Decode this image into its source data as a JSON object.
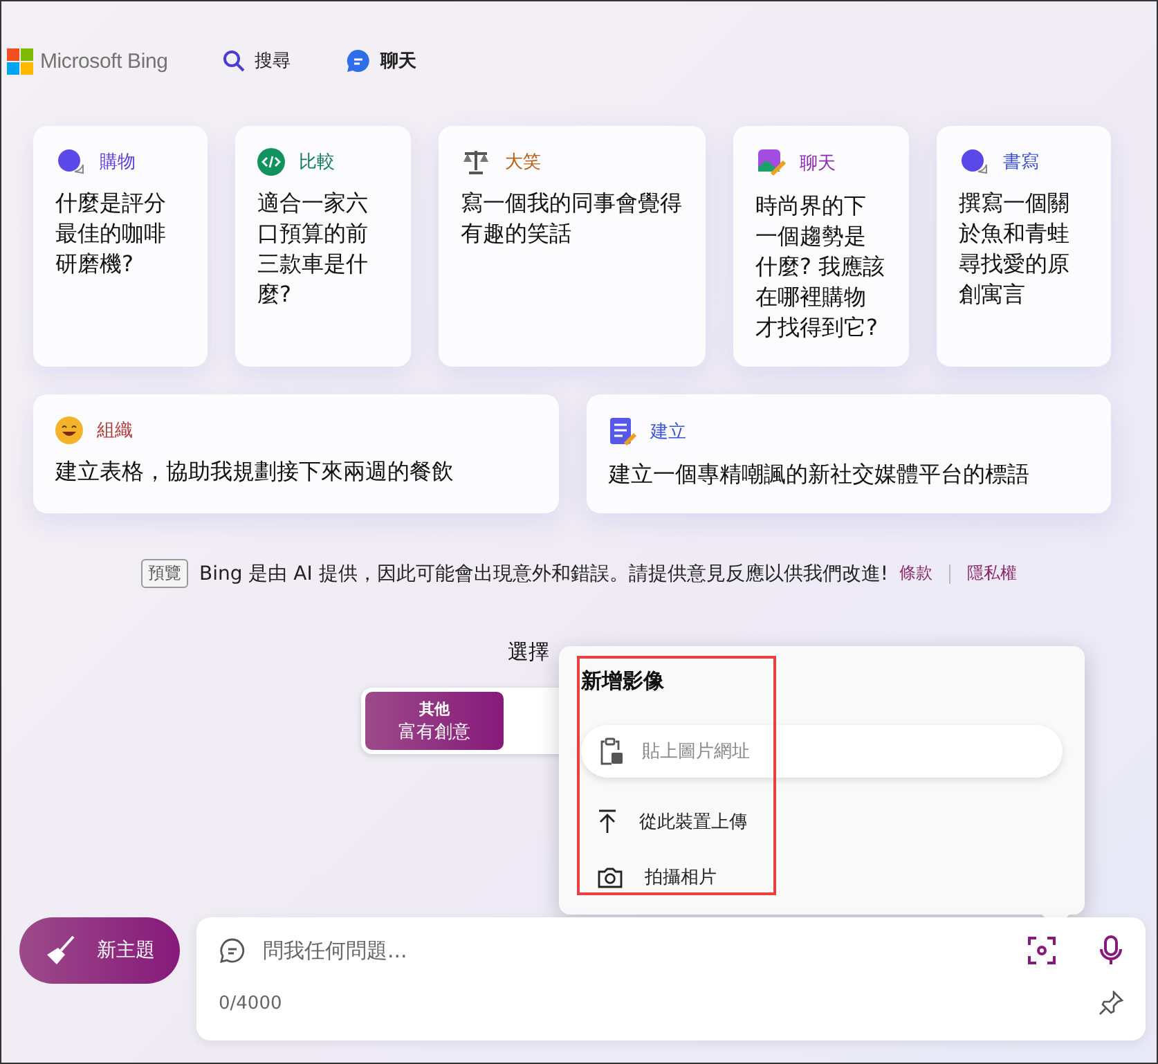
{
  "header": {
    "logo": "Microsoft Bing",
    "nav": [
      {
        "label": "搜尋",
        "kind": "search",
        "selected": false
      },
      {
        "label": "聊天",
        "kind": "chat",
        "selected": true
      }
    ]
  },
  "cards": [
    {
      "category": "購物",
      "color": "#5b3fe0",
      "kind": "bubble",
      "text": "什麼是評分最佳的咖啡研磨機?"
    },
    {
      "category": "比較",
      "color": "#0f7b5c",
      "kind": "code",
      "text": "適合一家六口預算的前三款車是什麼?"
    },
    {
      "category": "大笑",
      "color": "#b8621b",
      "kind": "scales",
      "text": "寫一個我的同事會覺得有趣的笑話"
    },
    {
      "category": "聊天",
      "color": "#8b2ab3",
      "kind": "paint",
      "text": "時尚界的下一個趨勢是什麼? 我應該在哪裡購物才找得到它?"
    },
    {
      "category": "書寫",
      "color": "#3b4fd8",
      "kind": "bubble",
      "text": "撰寫一個關於魚和青蛙尋找愛的原創寓言"
    },
    {
      "category": "組織",
      "color": "#b03a3a",
      "kind": "smile",
      "text": "建立表格，協助我規劃接下來兩週的餐飲"
    },
    {
      "category": "建立",
      "color": "#3b55d8",
      "kind": "note",
      "text": "建立一個專精嘲諷的新社交媒體平台的標語"
    }
  ],
  "disclaimer": {
    "badge": "預覽",
    "text": "Bing 是由 AI 提供，因此可能會出現意外和錯誤。請提供意見反應以供我們改進!",
    "links": [
      "條款",
      "隱私權"
    ]
  },
  "tone": {
    "title": "選擇",
    "options": [
      {
        "top": "其他",
        "label": "富有創意",
        "selected": true
      }
    ]
  },
  "popup": {
    "title": "新增影像",
    "highlighted": true,
    "url_field": {
      "placeholder": "貼上圖片網址"
    },
    "items": [
      {
        "kind": "upload",
        "label": "從此裝置上傳"
      },
      {
        "kind": "camera",
        "label": "拍攝相片"
      }
    ]
  },
  "new_topic": "新主題",
  "input": {
    "placeholder": "問我任何問題...",
    "counter": "0/4000"
  }
}
